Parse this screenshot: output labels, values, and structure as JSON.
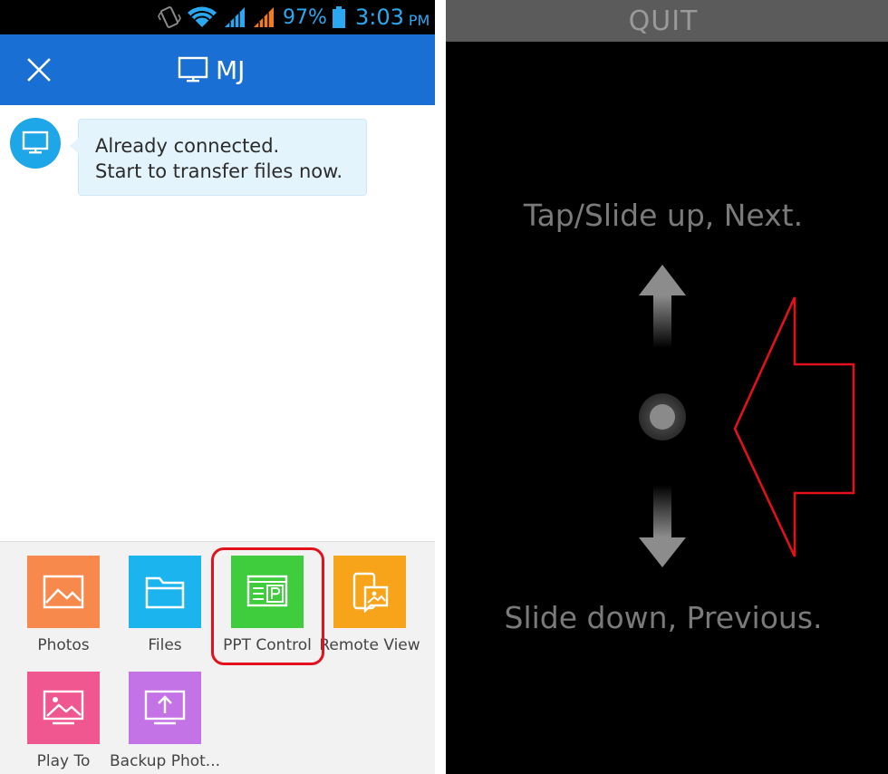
{
  "status_bar": {
    "battery_percent": "97%",
    "time": "3:03",
    "time_suffix": "PM",
    "icons": [
      "vibrate-icon",
      "wifi-icon",
      "signal-icon",
      "signal-icon",
      "battery-icon"
    ]
  },
  "header": {
    "title": "MJ",
    "close_icon": "close-icon",
    "title_icon": "monitor-icon",
    "color": "#1a6fd4"
  },
  "message": {
    "avatar_icon": "monitor-icon",
    "lines": [
      "Already connected.",
      "Start to transfer files now."
    ]
  },
  "tools": [
    {
      "label": "Photos",
      "icon": "photo-icon",
      "color": "#f7894d"
    },
    {
      "label": "Files",
      "icon": "folder-icon",
      "color": "#1cb4ef"
    },
    {
      "label": "PPT Control",
      "icon": "ppt-icon",
      "color": "#3fcc3d"
    },
    {
      "label": "Remote View",
      "icon": "remote-view-icon",
      "color": "#f7a41a"
    },
    {
      "label": "Play To",
      "icon": "play-to-icon",
      "color": "#f0568f"
    },
    {
      "label": "Backup Phot...",
      "icon": "backup-icon",
      "color": "#c373e6"
    }
  ],
  "ppt_screen": {
    "quit_label": "QUIT",
    "next_hint": "Tap/Slide up, Next.",
    "previous_hint": "Slide down, Previous."
  },
  "annotation_color": "#e2111b"
}
